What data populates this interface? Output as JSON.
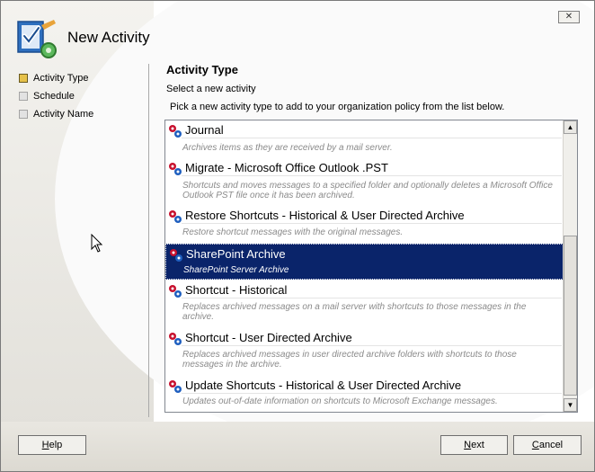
{
  "window": {
    "title": "New Activity",
    "close_label": "✕"
  },
  "steps": [
    {
      "label": "Activity Type",
      "active": true
    },
    {
      "label": "Schedule",
      "active": false
    },
    {
      "label": "Activity Name",
      "active": false
    }
  ],
  "main": {
    "heading": "Activity Type",
    "sub_label": "Select a new activity",
    "instructions": "Pick a new activity type to add to your organization policy from the list below."
  },
  "activities": [
    {
      "title": "Journal",
      "description": "Archives items as they are received by a mail server.",
      "selected": false,
      "icon": "gear-cluster-icon"
    },
    {
      "title": "Migrate - Microsoft Office Outlook .PST",
      "description": "Shortcuts and moves messages to a specified folder and optionally deletes a Microsoft Office Outlook PST file once it has been archived.",
      "selected": false,
      "icon": "gear-cluster-icon"
    },
    {
      "title": "Restore Shortcuts - Historical & User Directed Archive",
      "description": "Restore shortcut messages with the original messages.",
      "selected": false,
      "icon": "gear-cluster-icon"
    },
    {
      "title": "SharePoint Archive",
      "description": "SharePoint Server Archive",
      "selected": true,
      "icon": "gear-cluster-icon"
    },
    {
      "title": "Shortcut - Historical",
      "description": "Replaces archived messages on a mail server with shortcuts to those messages in the archive.",
      "selected": false,
      "icon": "gear-cluster-icon"
    },
    {
      "title": "Shortcut - User Directed Archive",
      "description": "Replaces archived messages in user directed archive folders with shortcuts to those messages in the archive.",
      "selected": false,
      "icon": "gear-cluster-icon"
    },
    {
      "title": "Update Shortcuts - Historical & User Directed Archive",
      "description": "Updates out-of-date information on shortcuts to Microsoft Exchange messages.",
      "selected": false,
      "icon": "gear-cluster-icon"
    }
  ],
  "scrollbar": {
    "up": "▲",
    "down": "▼"
  },
  "buttons": {
    "help_key": "H",
    "help_rest": "elp",
    "next_key": "N",
    "next_rest": "ext",
    "cancel_key": "C",
    "cancel_rest": "ancel"
  },
  "colors": {
    "selection": "#0a246a",
    "active_step": "#e6c14a",
    "gear_red": "#c8102e",
    "gear_blue": "#1f5fbf"
  }
}
